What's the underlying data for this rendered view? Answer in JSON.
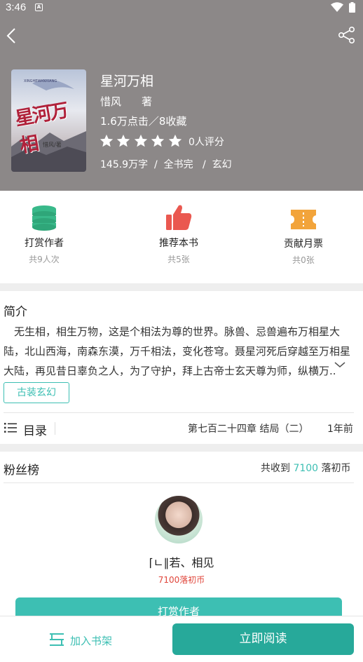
{
  "status_bar": {
    "time": "3:46",
    "notification_glyph": "A"
  },
  "book": {
    "title": "星河万相",
    "author": "惜风",
    "author_tag": "著",
    "stats": "1.6万点击／8收藏",
    "rating_stars": 0,
    "rating_text": "0人评分",
    "meta": "145.9万字  /  全书完   /  玄幻",
    "cover": {
      "title": "星河万相",
      "author": "惜风/著",
      "subtitle": "XINGHEWANXIANG"
    }
  },
  "actions": [
    {
      "label": "打赏作者",
      "sub": "共9人次",
      "icon": "coins-icon",
      "color": "#39b98a"
    },
    {
      "label": "推荐本书",
      "sub": "共5张",
      "icon": "thumbs-up-icon",
      "color": "#ea5850"
    },
    {
      "label": "贡献月票",
      "sub": "共0张",
      "icon": "ticket-icon",
      "color": "#f2a43b"
    }
  ],
  "intro": {
    "title": "简介",
    "text": "无生相，相生万物，这是个相法为尊的世界。脉兽、忌兽遍布万相星大陆，北山西海，南森东漠，万千相法，变化苍穹。聂星河死后穿越至万相星大陆，再见昔日辜负之人，为了守护，拜上古帝士玄天尊为师，纵横万..",
    "tag": "古装玄幻"
  },
  "catalog": {
    "label": "目录",
    "latest_chapter": "第七百二十四章 结局（二）",
    "time": "1年前"
  },
  "fans": {
    "title": "粉丝榜",
    "received_prefix": "共收到",
    "received_amount": "7100",
    "received_unit": "落初币",
    "top_fan_name": "⌈ㄴ∥若、相见",
    "top_fan_coins": "7100落初币",
    "reward_button": "打赏作者"
  },
  "bottom": {
    "shelf_label": "加入书架",
    "read_label": "立即阅读"
  },
  "colors": {
    "accent": "#3dbfb3",
    "read_button": "#27a99a",
    "header_bg": "#8c8888",
    "danger": "#e0463b"
  }
}
